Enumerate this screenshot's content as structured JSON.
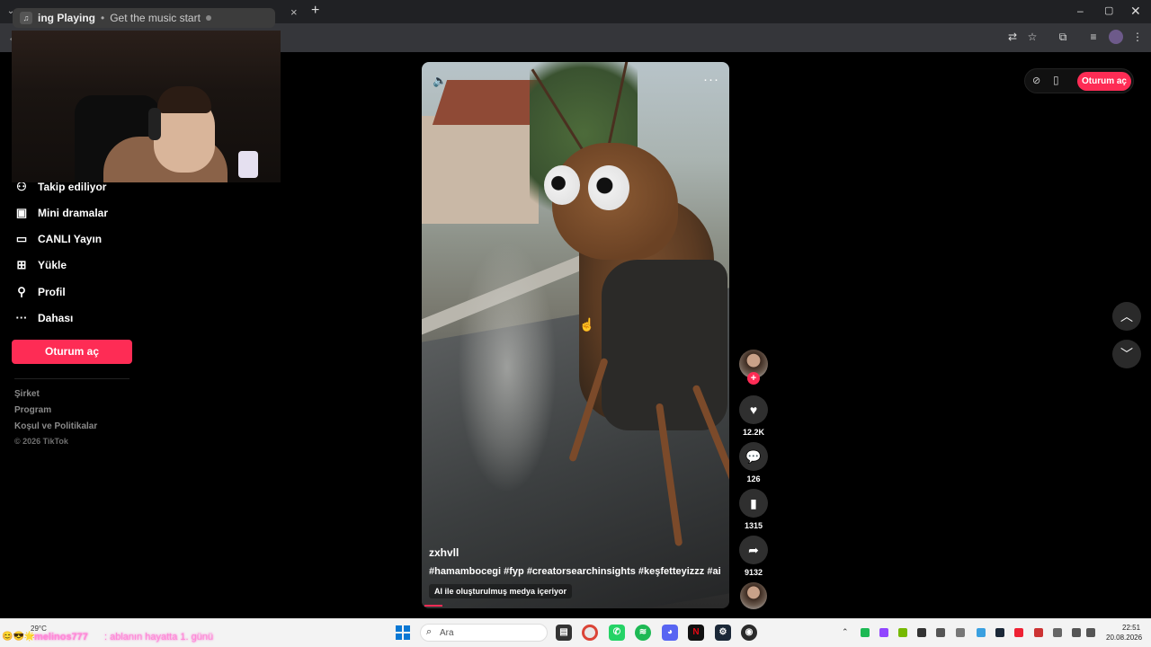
{
  "browser": {
    "media_tab_label": "ing Playing",
    "media_tab_subtitle": "Get the music start",
    "media_tab_separator": "•",
    "tab_close": "×",
    "new_tab": "+",
    "window_controls": {
      "minimize": "–",
      "maximize": "▢",
      "close": "✕"
    }
  },
  "sidebar": {
    "items": [
      {
        "label": "Takip ediliyor",
        "icon": "following-icon",
        "glyph": "⚇"
      },
      {
        "label": "Mini dramalar",
        "icon": "film-icon",
        "glyph": "▣"
      },
      {
        "label": "CANLI Yayın",
        "icon": "live-tv-icon",
        "glyph": "▭"
      },
      {
        "label": "Yükle",
        "icon": "upload-icon",
        "glyph": "⊞"
      },
      {
        "label": "Profil",
        "icon": "profile-icon",
        "glyph": "⚲"
      },
      {
        "label": "Dahası",
        "icon": "more-icon",
        "glyph": "···"
      }
    ],
    "login_button": "Oturum aç",
    "footer_links": [
      "Şirket",
      "Program",
      "Koşul ve Politikalar"
    ],
    "copyright": "© 2026 TikTok"
  },
  "video": {
    "username": "zxhvll",
    "hashtags": "#hamambocegi #fyp #creatorsearchinsights #keşfetteyizzz #ai",
    "ai_label": "AI ile oluşturulmuş medya içeriyor",
    "progress": 0.06
  },
  "actions": {
    "likes": "12.2K",
    "comments": "126",
    "saves": "1315",
    "shares": "9132"
  },
  "top_right": {
    "login_button": "Oturum aç"
  },
  "taskbar": {
    "weather": "29°C",
    "search_placeholder": "Ara",
    "chat_name": "melinos777",
    "chat_message": ": ablanın hayatta 1. günü",
    "time": "22:51",
    "date": "20.08.2026"
  },
  "colors": {
    "accent": "#fe2c55",
    "background": "#000000",
    "taskbar": "#f3f3f3"
  }
}
